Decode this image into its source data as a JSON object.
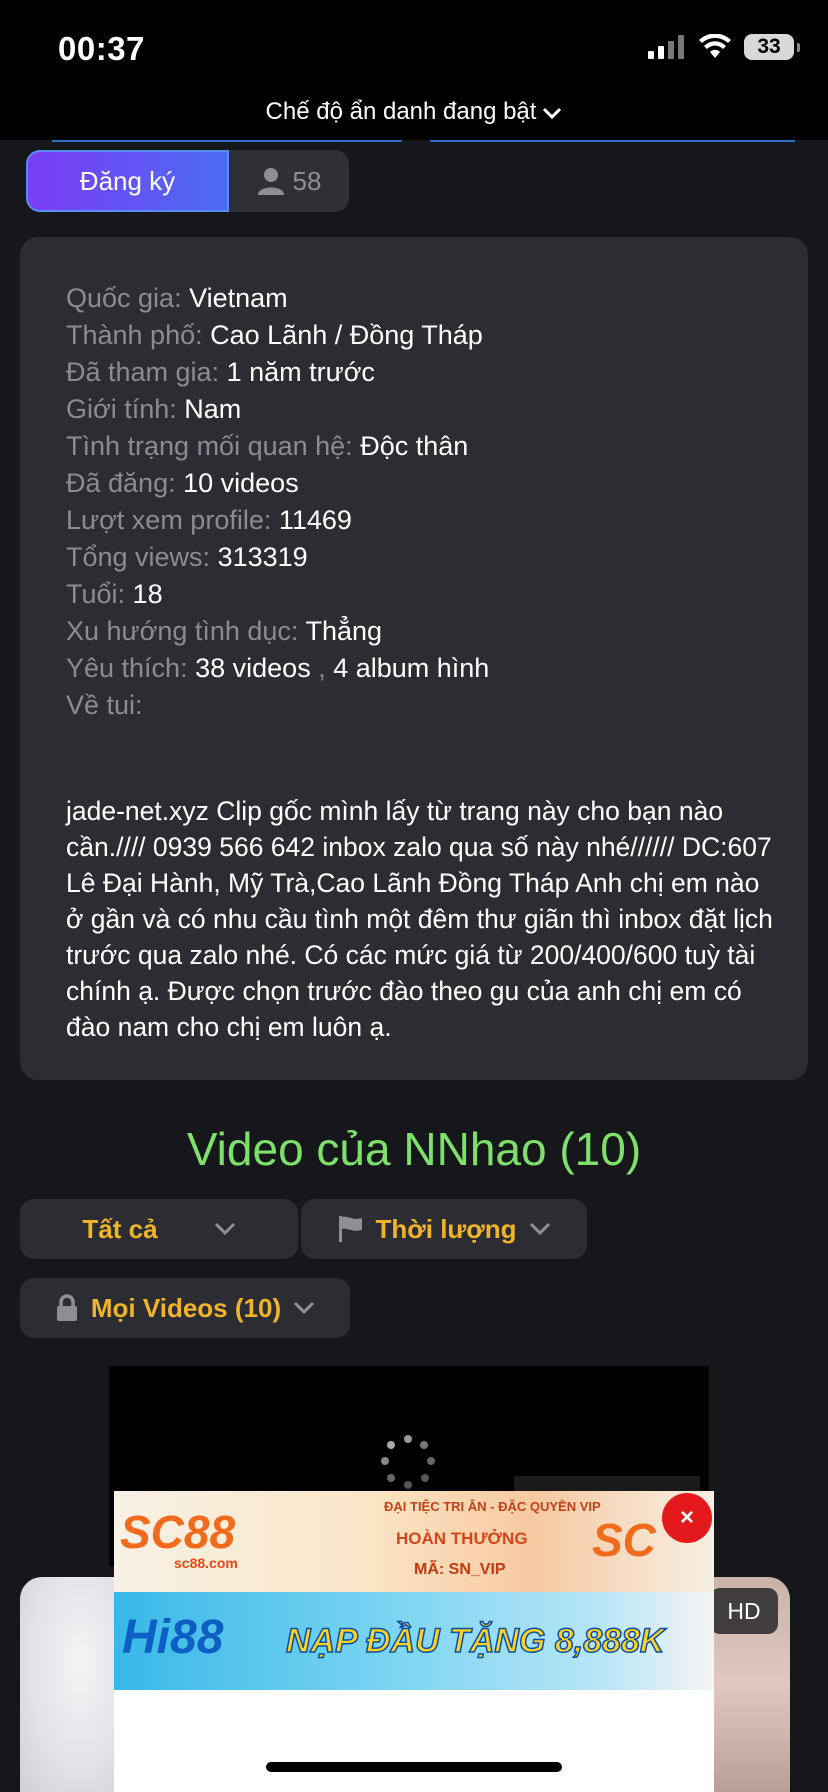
{
  "status_bar": {
    "time": "00:37",
    "battery": "33"
  },
  "browser": {
    "incognito_text": "Chế độ ẩn danh đang bật"
  },
  "profile": {
    "subscribe_label": "Đăng ký",
    "subscriber_count": "58",
    "info": [
      {
        "label": "Quốc gia:",
        "value": "Vietnam"
      },
      {
        "label": "Thành phố:",
        "value": "Cao Lãnh / Đồng Tháp"
      },
      {
        "label": "Đã tham gia:",
        "value": "1 năm trước"
      },
      {
        "label": "Giới tính:",
        "value": "Nam"
      },
      {
        "label": "Tình trạng mối quan hệ:",
        "value": "Độc thân"
      },
      {
        "label": "Đã đăng:",
        "value": "10 videos"
      },
      {
        "label": "Lượt xem profile:",
        "value": "11469"
      },
      {
        "label": "Tổng views:",
        "value": "313319"
      },
      {
        "label": "Tuổi:",
        "value": "18"
      },
      {
        "label": "Xu hướng tình dục:",
        "value": "Thẳng"
      },
      {
        "label": "Yêu thích:",
        "value": "38 videos",
        "sep": " , ",
        "value2": "4 album hình"
      },
      {
        "label": "Về tui:",
        "value": ""
      }
    ],
    "about": "jade-net.xyz Clip gốc mình lấy từ trang này cho bạn nào cần.//// 0939 566 642 inbox zalo qua số này nhé////// DC:607 Lê Đại Hành, Mỹ Trà,Cao Lãnh Đồng Tháp Anh chị em nào ở gần và có nhu cầu tình một đêm thư giãn thì inbox đặt lịch trước qua zalo nhé. Có các mức giá từ 200/400/600 tuỳ tài chính ạ. Được chọn trước đào theo gu của anh chị em có đào nam cho chị em luôn ạ."
  },
  "videos_section": {
    "title": "Video của NNhao (10)",
    "filter_all": "Tất cả",
    "filter_duration": "Thời lượng",
    "filter_privacy": "Mọi Videos (10)",
    "hd_badge": "HD"
  },
  "ads": {
    "ad1_logo": "SC88",
    "ad1_domain": "sc88.com",
    "ad1_tag": "ĐẠI TIỆC TRI ÂN - ĐẶC QUYỀN VIP",
    "ad1_promo": "HOÀN THƯỞNG",
    "ad1_code": "MÃ: SN_VIP",
    "ad1_logo2": "SC",
    "ad2_logo": "Hi88",
    "ad2_promo": "NẠP ĐẦU TẶNG 8,888K",
    "close_symbol": "×"
  },
  "colors": {
    "accent_green": "#7ee06a",
    "filter_yellow": "#f0b429",
    "subscribe_gradient_start": "#7a3cf5",
    "subscribe_gradient_end": "#4c6cf2",
    "close_red": "#e3191b"
  }
}
